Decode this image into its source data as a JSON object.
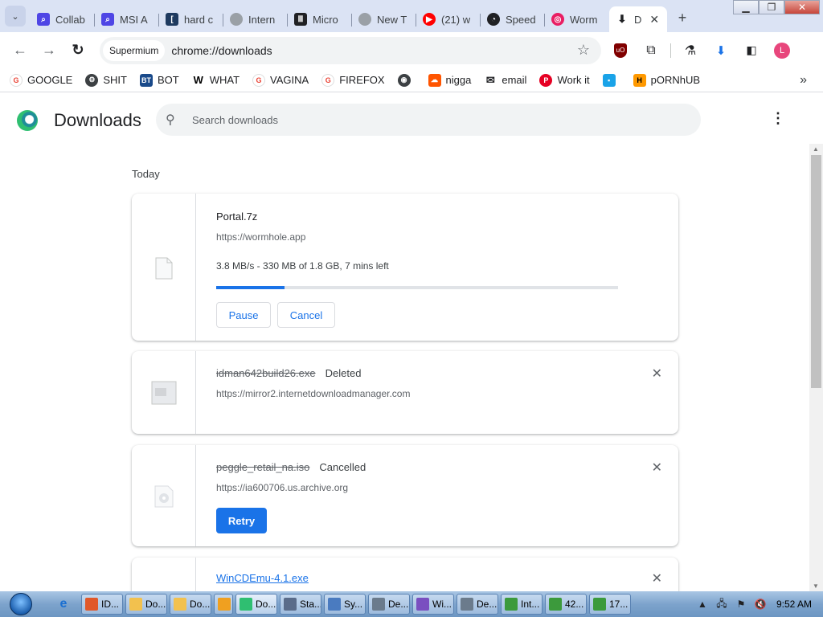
{
  "browser": {
    "tabs": [
      {
        "label": "Collab",
        "icon": "search-icon",
        "color": "#4f46e5"
      },
      {
        "label": "MSI A",
        "icon": "search-icon",
        "color": "#4f46e5"
      },
      {
        "label": "hard c",
        "icon": "bracket-icon",
        "color": "#1e3a5f"
      },
      {
        "label": "Intern",
        "icon": "globe-icon",
        "color": "#9aa0a6"
      },
      {
        "label": "Micro",
        "icon": "museum-icon",
        "color": "#202124"
      },
      {
        "label": "New T",
        "icon": "globe-icon",
        "color": "#9aa0a6"
      },
      {
        "label": "(21) w",
        "icon": "youtube-icon",
        "color": "#ff0000"
      },
      {
        "label": "Speed",
        "icon": "speedometer-icon",
        "color": "#202124"
      },
      {
        "label": "Worm",
        "icon": "wormhole-icon",
        "color": "#e91e63"
      },
      {
        "label": "D",
        "icon": "download-icon",
        "color": "#202124"
      }
    ],
    "tab_close_glyph": "✕",
    "new_tab_glyph": "+",
    "omnibox": {
      "chip": "Supermium",
      "url": "chrome://downloads"
    },
    "window_controls": {
      "minimize": "▁",
      "maximize": "❐",
      "close": "✕"
    },
    "avatar_letter": "L"
  },
  "bookmarks": {
    "items": [
      {
        "label": "GOOGLE",
        "icon": "google-icon",
        "color": "#ea4335"
      },
      {
        "label": "SHIT",
        "icon": "gear-icon",
        "color": "#3c4043"
      },
      {
        "label": "BOT",
        "icon": "bot-icon",
        "color": "#1a4a8a"
      },
      {
        "label": "WHAT",
        "icon": "w-icon",
        "color": "#000000"
      },
      {
        "label": "VAGINA",
        "icon": "google-icon",
        "color": "#ea4335"
      },
      {
        "label": "FIREFOX",
        "icon": "google-icon",
        "color": "#ea4335"
      },
      {
        "label": "",
        "icon": "globe-icon",
        "color": "#3c4043"
      },
      {
        "label": "nigga",
        "icon": "soundcloud-icon",
        "color": "#ff5500"
      },
      {
        "label": "email",
        "icon": "mail-icon",
        "color": "#202124"
      },
      {
        "label": "Work it",
        "icon": "pinterest-icon",
        "color": "#e60023"
      },
      {
        "label": "",
        "icon": "bookmark-icon",
        "color": "#1aa3e8"
      },
      {
        "label": "pORNhUB",
        "icon": "ph-icon",
        "color": "#ff9900"
      }
    ],
    "more_glyph": "»"
  },
  "downloads": {
    "title": "Downloads",
    "search_placeholder": "Search downloads",
    "section_label": "Today",
    "items": [
      {
        "filename": "Portal.7z",
        "url": "https://wormhole.app",
        "progress_text": "3.8 MB/s - 330 MB of 1.8 GB, 7 mins left",
        "progress_fraction": 0.17,
        "buttons": {
          "pause": "Pause",
          "cancel": "Cancel"
        }
      },
      {
        "filename": "idman642build26.exe",
        "status": "Deleted",
        "url": "https://mirror2.internetdownloadmanager.com"
      },
      {
        "filename": "peggle_retail_na.iso",
        "status": "Cancelled",
        "url": "https://ia600706.us.archive.org",
        "retry_label": "Retry"
      },
      {
        "filename": "WinCDEmu-4.1.exe"
      }
    ],
    "remove_glyph": "✕"
  },
  "taskbar": {
    "tasks": [
      {
        "label": "ID...",
        "color": "#e0582a"
      },
      {
        "label": "Do...",
        "color": "#f2c14e"
      },
      {
        "label": "Do...",
        "color": "#f2c14e"
      },
      {
        "label": "",
        "color": "#f0a020"
      },
      {
        "label": "Do...",
        "color": "#2fbf71",
        "active": true
      },
      {
        "label": "Sta...",
        "color": "#5a6c8a"
      },
      {
        "label": "Sy...",
        "color": "#4a7bc0"
      },
      {
        "label": "De...",
        "color": "#6b7b8c"
      },
      {
        "label": "Wi...",
        "color": "#7a4fc0"
      },
      {
        "label": "De...",
        "color": "#6b7b8c"
      },
      {
        "label": "Int...",
        "color": "#3c9a3c"
      },
      {
        "label": "42...",
        "color": "#3c9a3c"
      },
      {
        "label": "17...",
        "color": "#3c9a3c"
      }
    ],
    "clock": "9:52 AM"
  }
}
